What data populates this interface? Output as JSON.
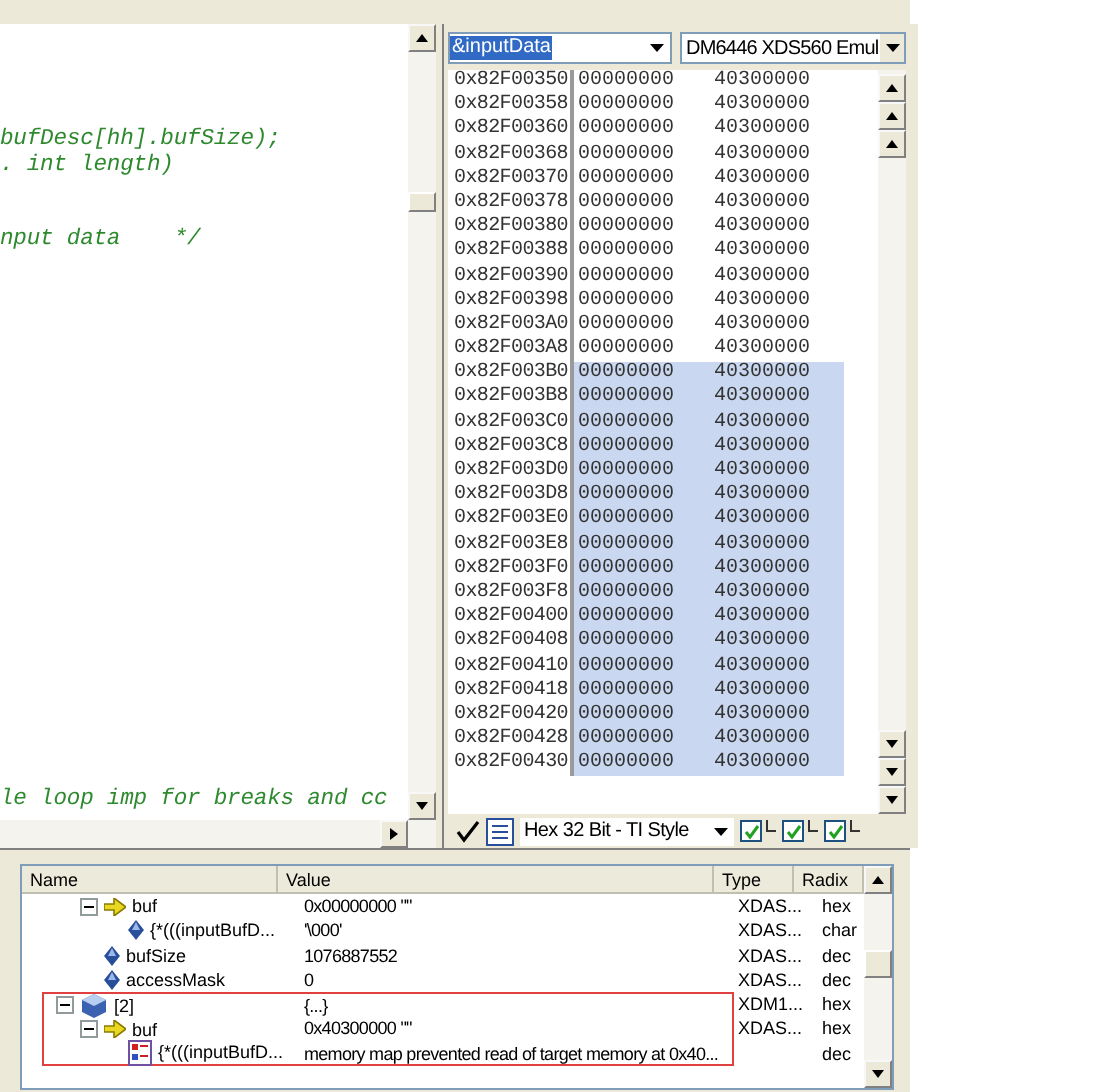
{
  "editor": {
    "lines": [
      "bufDesc[hh].bufSize);",
      ". int length)",
      "nput data    */",
      "le loop imp for breaks and cc"
    ]
  },
  "memory": {
    "address_field": "&inputData",
    "target_field": "DM6446 XDS560 Emul",
    "format_field": "Hex 32 Bit - TI Style",
    "rows": [
      {
        "address": "0x82F00350",
        "words": [
          "00000000",
          "40300000"
        ],
        "selected": false
      },
      {
        "address": "0x82F00358",
        "words": [
          "00000000",
          "40300000"
        ],
        "selected": false
      },
      {
        "address": "0x82F00360",
        "words": [
          "00000000",
          "40300000"
        ],
        "selected": false
      },
      {
        "address": "0x82F00368",
        "words": [
          "00000000",
          "40300000"
        ],
        "selected": false
      },
      {
        "address": "0x82F00370",
        "words": [
          "00000000",
          "40300000"
        ],
        "selected": false
      },
      {
        "address": "0x82F00378",
        "words": [
          "00000000",
          "40300000"
        ],
        "selected": false
      },
      {
        "address": "0x82F00380",
        "words": [
          "00000000",
          "40300000"
        ],
        "selected": false
      },
      {
        "address": "0x82F00388",
        "words": [
          "00000000",
          "40300000"
        ],
        "selected": false
      },
      {
        "address": "0x82F00390",
        "words": [
          "00000000",
          "40300000"
        ],
        "selected": false
      },
      {
        "address": "0x82F00398",
        "words": [
          "00000000",
          "40300000"
        ],
        "selected": false
      },
      {
        "address": "0x82F003A0",
        "words": [
          "00000000",
          "40300000"
        ],
        "selected": false
      },
      {
        "address": "0x82F003A8",
        "words": [
          "00000000",
          "40300000"
        ],
        "selected": false
      },
      {
        "address": "0x82F003B0",
        "words": [
          "00000000",
          "40300000"
        ],
        "selected": true
      },
      {
        "address": "0x82F003B8",
        "words": [
          "00000000",
          "40300000"
        ],
        "selected": true
      },
      {
        "address": "0x82F003C0",
        "words": [
          "00000000",
          "40300000"
        ],
        "selected": true
      },
      {
        "address": "0x82F003C8",
        "words": [
          "00000000",
          "40300000"
        ],
        "selected": true
      },
      {
        "address": "0x82F003D0",
        "words": [
          "00000000",
          "40300000"
        ],
        "selected": true
      },
      {
        "address": "0x82F003D8",
        "words": [
          "00000000",
          "40300000"
        ],
        "selected": true
      },
      {
        "address": "0x82F003E0",
        "words": [
          "00000000",
          "40300000"
        ],
        "selected": true
      },
      {
        "address": "0x82F003E8",
        "words": [
          "00000000",
          "40300000"
        ],
        "selected": true
      },
      {
        "address": "0x82F003F0",
        "words": [
          "00000000",
          "40300000"
        ],
        "selected": true
      },
      {
        "address": "0x82F003F8",
        "words": [
          "00000000",
          "40300000"
        ],
        "selected": true
      },
      {
        "address": "0x82F00400",
        "words": [
          "00000000",
          "40300000"
        ],
        "selected": true
      },
      {
        "address": "0x82F00408",
        "words": [
          "00000000",
          "40300000"
        ],
        "selected": true
      },
      {
        "address": "0x82F00410",
        "words": [
          "00000000",
          "40300000"
        ],
        "selected": true
      },
      {
        "address": "0x82F00418",
        "words": [
          "00000000",
          "40300000"
        ],
        "selected": true
      },
      {
        "address": "0x82F00420",
        "words": [
          "00000000",
          "40300000"
        ],
        "selected": true
      },
      {
        "address": "0x82F00428",
        "words": [
          "00000000",
          "40300000"
        ],
        "selected": true
      },
      {
        "address": "0x82F00430",
        "words": [
          "00000000",
          "40300000"
        ],
        "selected": true
      }
    ],
    "options": [
      {
        "checked": true
      },
      {
        "checked": true
      },
      {
        "checked": true
      }
    ]
  },
  "watch": {
    "columns": [
      "Name",
      "Value",
      "Type",
      "Radix"
    ],
    "tree": [
      {
        "kind": "continued",
        "children": [
          {
            "kind": "pointer",
            "name": "buf",
            "value": "0x00000000 \"\"",
            "type": "XDAS...",
            "radix": "hex",
            "expanded": true,
            "marked": false,
            "children": [
              {
                "kind": "field",
                "name": "{*(((inputBufD...",
                "value": "'\\000'",
                "type": "XDAS...",
                "radix": "char",
                "marked": false
              }
            ]
          },
          {
            "kind": "field",
            "name": "bufSize",
            "value": "1076887552",
            "type": "XDAS...",
            "radix": "dec",
            "marked": false
          },
          {
            "kind": "field",
            "name": "accessMask",
            "value": "0",
            "type": "XDAS...",
            "radix": "dec",
            "marked": false
          }
        ]
      },
      {
        "kind": "struct",
        "name": "[2]",
        "value": "{...}",
        "type": "XDM1...",
        "radix": "hex",
        "expanded": true,
        "marked": true,
        "children": [
          {
            "kind": "pointer",
            "name": "buf",
            "value": "0x40300000 \"\"",
            "type": "XDAS...",
            "radix": "hex",
            "expanded": true,
            "marked": true,
            "children": [
              {
                "kind": "error",
                "name": "{*(((inputBufD...",
                "value": "memory map prevented read of target memory at 0x40...",
                "radix": "dec",
                "marked": true
              }
            ]
          }
        ]
      }
    ]
  }
}
